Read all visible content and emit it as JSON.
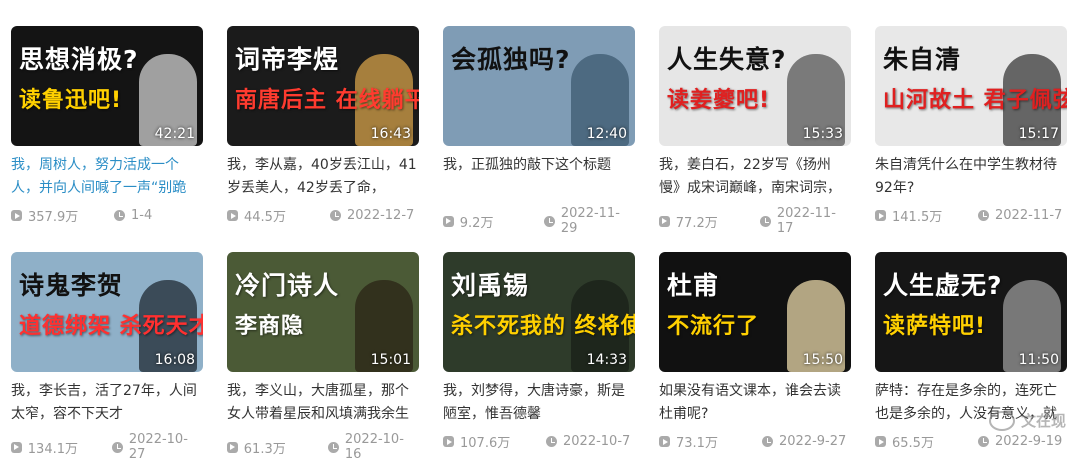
{
  "videos": [
    {
      "thumb_line1": "思想消极?",
      "thumb_line2": "读鲁迅吧!",
      "line2_color": "#ffd000",
      "bg": "#141414",
      "fig": "#cfcfcf",
      "duration": "42:21",
      "title": "我，周树人，努力活成一个人，并向人间喊了一声“别跪",
      "title_color": "link",
      "views": "357.9万",
      "date": "1-4"
    },
    {
      "thumb_line1": "词帝李煜",
      "thumb_line2": "南唐后主 在线躺平",
      "line2_color": "#ff3b2f",
      "bg": "#1b1b1b",
      "fig": "#d6a24a",
      "duration": "16:43",
      "title": "我，李从嘉，40岁丢江山，41岁丢美人，42岁丢了命，",
      "title_color": "normal",
      "views": "44.5万",
      "date": "2022-12-7"
    },
    {
      "thumb_line1": "会孤独吗?",
      "thumb_line2": "",
      "line2_color": "#ffffff",
      "bg": "#7f9cb5",
      "fig": "#3c5a70",
      "duration": "12:40",
      "title": "我，正孤独的敲下这个标题",
      "title_color": "normal",
      "views": "9.2万",
      "date": "2022-11-29"
    },
    {
      "thumb_line1": "人生失意?",
      "thumb_line2": "读姜夔吧!",
      "line2_color": "#e02020",
      "bg": "#e6e6e6",
      "fig": "#555555",
      "duration": "15:33",
      "title": "我，姜白石，22岁写《扬州慢》成宋词巅峰，南宋词宗，",
      "title_color": "normal",
      "views": "77.2万",
      "date": "2022-11-17"
    },
    {
      "thumb_line1": "朱自清",
      "thumb_line2": "山河故土 君子佩弦",
      "line2_color": "#e02020",
      "bg": "#e8e8e8",
      "fig": "#3a3a3a",
      "duration": "15:17",
      "title": "朱自清凭什么在中学生教材待92年?",
      "title_color": "normal",
      "views": "141.5万",
      "date": "2022-11-7"
    },
    {
      "thumb_line1": "诗鬼李贺",
      "thumb_line2": "道德绑架 杀死天才",
      "line2_color": "#ff3030",
      "bg": "#8fb0c8",
      "fig": "#1f2a33",
      "duration": "16:08",
      "title": "我，李长吉，活了27年，人间太窄，容不下天才",
      "title_color": "normal",
      "views": "134.1万",
      "date": "2022-10-27"
    },
    {
      "thumb_line1": "冷门诗人",
      "thumb_line2": "李商隐",
      "line2_color": "#ffffff",
      "bg": "#4b5a36",
      "fig": "#2a2416",
      "duration": "15:01",
      "title": "我，李义山，大唐孤星，那个女人带着星辰和风填满我余生",
      "title_color": "normal",
      "views": "61.3万",
      "date": "2022-10-16"
    },
    {
      "thumb_line1": "刘禹锡",
      "thumb_line2": "杀不死我的 终将使我强大",
      "line2_color": "#ffd000",
      "bg": "#2e3b2a",
      "fig": "#1a2018",
      "duration": "14:33",
      "title": "我，刘梦得，大唐诗豪，斯是陋室，惟吾德馨",
      "title_color": "normal",
      "views": "107.6万",
      "date": "2022-10-7"
    },
    {
      "thumb_line1": "杜甫",
      "thumb_line2": "不流行了",
      "line2_color": "#ffd000",
      "bg": "#111111",
      "fig": "#e8d7a8",
      "duration": "15:50",
      "title": "如果没有语文课本，谁会去读杜甫呢?",
      "title_color": "normal",
      "views": "73.1万",
      "date": "2022-9-27"
    },
    {
      "thumb_line1": "人生虚无?",
      "thumb_line2": "读萨特吧!",
      "line2_color": "#ffd000",
      "bg": "#161616",
      "fig": "#9a9a9a",
      "duration": "11:50",
      "title": "萨特：存在是多余的，连死亡也是多余的，人没有意义，就是头",
      "title_color": "normal",
      "views": "65.5万",
      "date": "2022-9-19"
    }
  ],
  "watermark": "文在现"
}
